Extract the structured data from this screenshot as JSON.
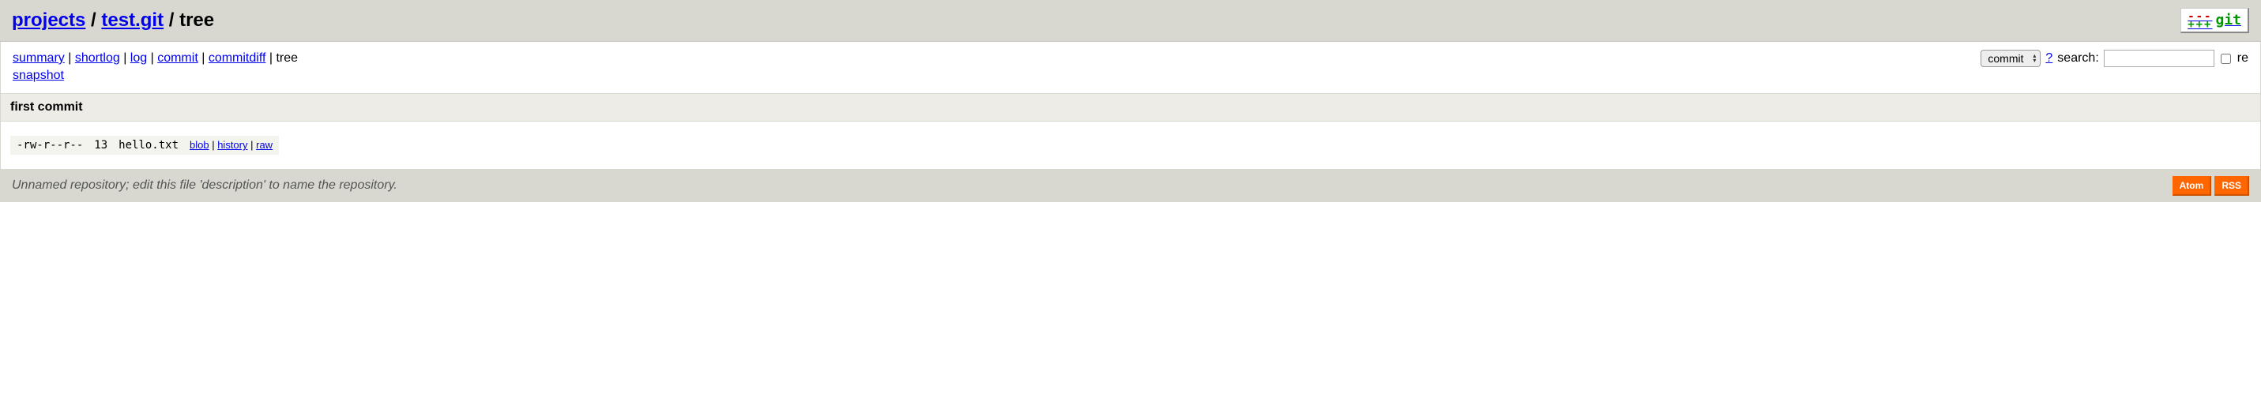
{
  "header": {
    "projects_label": "projects",
    "repo_label": "test.git",
    "page_label": "tree",
    "sep": " / "
  },
  "git_logo": {
    "minus": "---",
    "plus": "+++",
    "text": "git"
  },
  "nav": {
    "summary": "summary",
    "shortlog": "shortlog",
    "log": "log",
    "commit": "commit",
    "commitdiff": "commitdiff",
    "tree": "tree",
    "snapshot": "snapshot",
    "sep": " | "
  },
  "search": {
    "select_value": "commit",
    "help": "?",
    "label": "search:",
    "re_label": "re"
  },
  "commit_title": "first commit",
  "tree": {
    "mode": "-rw-r--r--",
    "size": "13",
    "name": "hello.txt",
    "blob": "blob",
    "history": "history",
    "raw": "raw",
    "sep": " | "
  },
  "footer": {
    "description": "Unnamed repository; edit this file 'description' to name the repository.",
    "atom": "Atom",
    "rss": "RSS"
  }
}
